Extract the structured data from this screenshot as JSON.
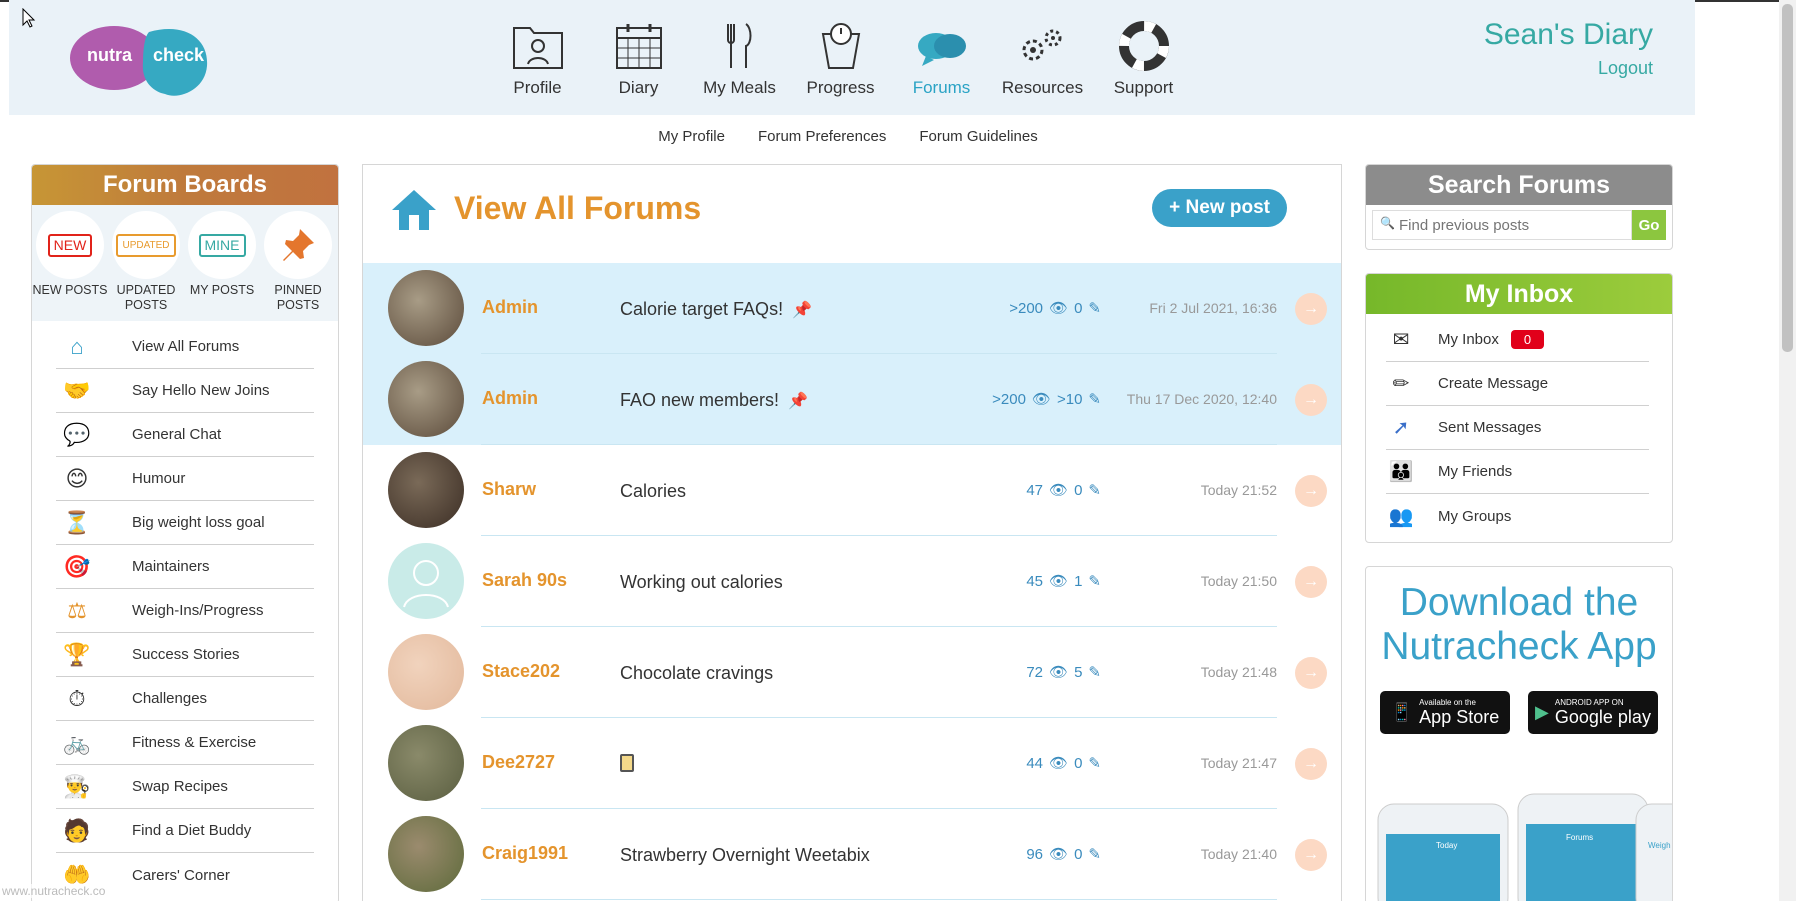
{
  "header": {
    "logo_text": [
      "nutra",
      "check"
    ],
    "nav": [
      {
        "label": "Profile",
        "icon": "profile-folder-icon"
      },
      {
        "label": "Diary",
        "icon": "calendar-icon"
      },
      {
        "label": "My Meals",
        "icon": "cutlery-icon"
      },
      {
        "label": "Progress",
        "icon": "scales-icon"
      },
      {
        "label": "Forums",
        "icon": "speech-bubbles-icon",
        "active": true
      },
      {
        "label": "Resources",
        "icon": "gears-icon"
      },
      {
        "label": "Support",
        "icon": "lifebuoy-icon"
      }
    ],
    "user_title": "Sean's Diary",
    "logout": "Logout"
  },
  "subnav": [
    "My Profile",
    "Forum Preferences",
    "Forum Guidelines"
  ],
  "left": {
    "title": "Forum Boards",
    "quick": [
      {
        "badge": "NEW",
        "color": "#e1231a",
        "label": "NEW POSTS"
      },
      {
        "badge": "UPDATED",
        "color": "#e89b2e",
        "label": "UPDATED POSTS"
      },
      {
        "badge": "MINE",
        "color": "#36a9a3",
        "label": "MY POSTS"
      },
      {
        "badge": "",
        "color": "#e4942d",
        "label": "PINNED POSTS"
      }
    ],
    "boards": [
      "View All Forums",
      "Say Hello New Joins",
      "General Chat",
      "Humour",
      "Big weight loss goal",
      "Maintainers",
      "Weigh-Ins/Progress",
      "Success Stories",
      "Challenges",
      "Fitness & Exercise",
      "Swap Recipes",
      "Find a Diet Buddy",
      "Carers' Corner"
    ]
  },
  "center": {
    "title": "View All Forums",
    "new_post": "+ New post",
    "rows": [
      {
        "user": "Admin",
        "subject": "Calorie target FAQs!",
        "pinned": true,
        "views": ">200",
        "replies": "0",
        "date": "Fri 2 Jul 2021, 16:36"
      },
      {
        "user": "Admin",
        "subject": "FAO new members!",
        "pinned": true,
        "views": ">200",
        "replies": ">10",
        "date": "Thu 17 Dec 2020, 12:40"
      },
      {
        "user": "Sharw",
        "subject": "Calories",
        "pinned": false,
        "views": "47",
        "replies": "0",
        "date": "Today 21:52"
      },
      {
        "user": "Sarah 90s",
        "subject": "Working out calories",
        "pinned": false,
        "views": "45",
        "replies": "1",
        "date": "Today 21:50"
      },
      {
        "user": "Stace202",
        "subject": "Chocolate cravings",
        "pinned": false,
        "views": "72",
        "replies": "5",
        "date": "Today 21:48"
      },
      {
        "user": "Dee2727",
        "subject": "",
        "pinned": false,
        "views": "44",
        "replies": "0",
        "date": "Today 21:47"
      },
      {
        "user": "Craig1991",
        "subject": "Strawberry Overnight Weetabix",
        "pinned": false,
        "views": "96",
        "replies": "0",
        "date": "Today 21:40"
      }
    ]
  },
  "right": {
    "search_title": "Search Forums",
    "search_placeholder": "Find previous posts",
    "go": "Go",
    "inbox_title": "My Inbox",
    "inbox": [
      {
        "label": "My Inbox",
        "badge": "0"
      },
      {
        "label": "Create Message"
      },
      {
        "label": "Sent Messages"
      },
      {
        "label": "My Friends"
      },
      {
        "label": "My Groups"
      }
    ],
    "app_title_line1": "Download the",
    "app_title_line2": "Nutracheck App",
    "app_store_small": "Available on the",
    "app_store": "App Store",
    "google_small": "ANDROID APP ON",
    "google": "Google play",
    "phone_screen_texts": [
      "Today",
      "Forums",
      "Weigh"
    ]
  },
  "footer_url": "www.nutracheck.co"
}
